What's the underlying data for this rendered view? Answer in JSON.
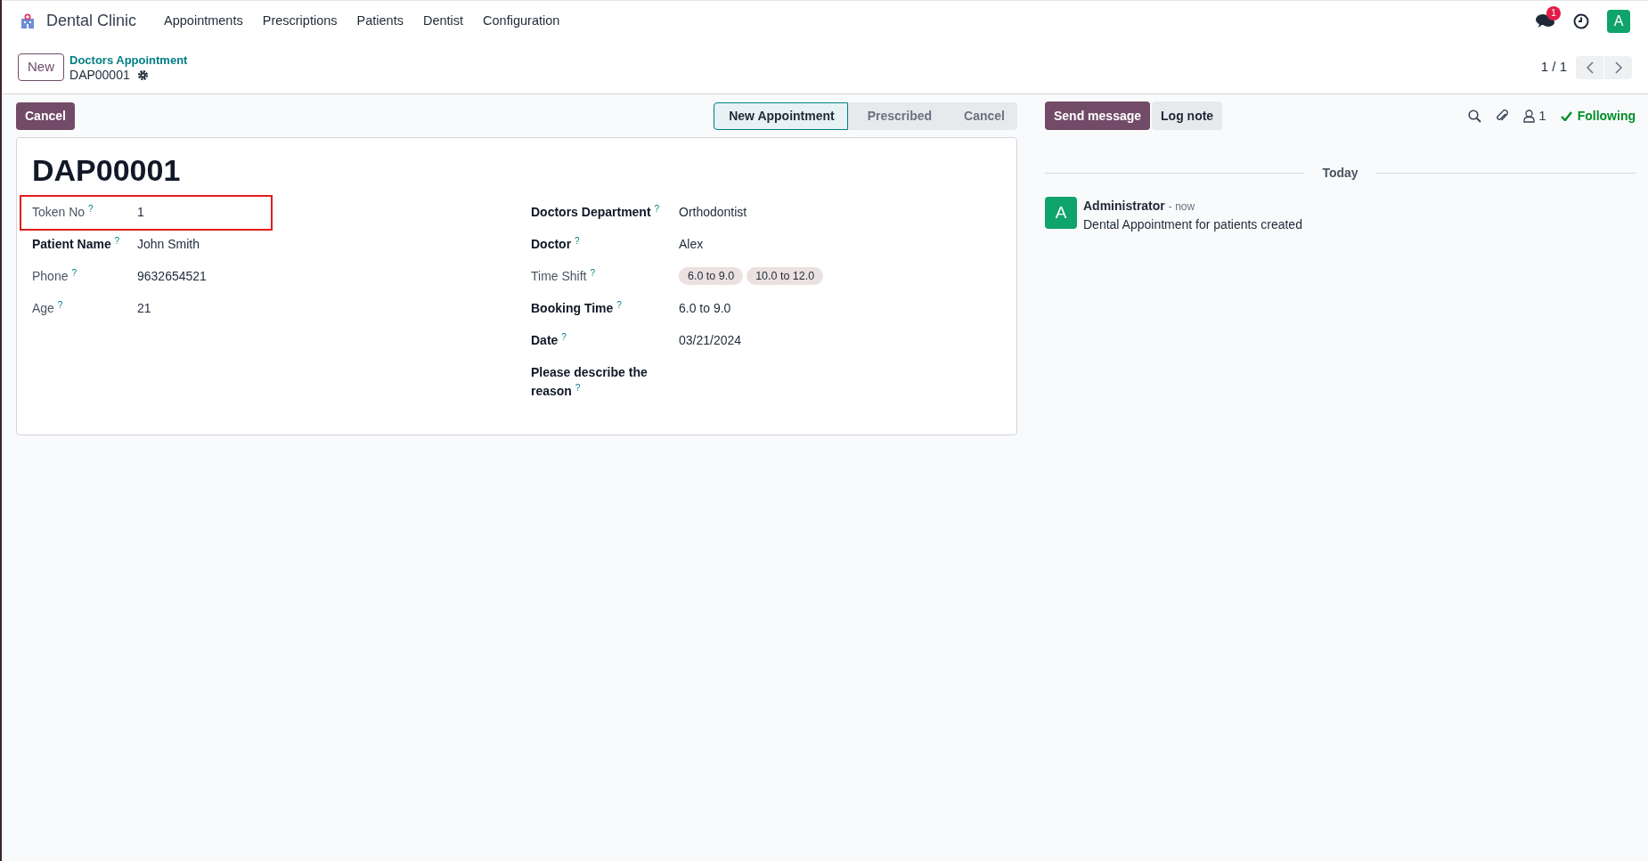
{
  "navbar": {
    "app_name": "Dental Clinic",
    "menu": [
      "Appointments",
      "Prescriptions",
      "Patients",
      "Dentist",
      "Configuration"
    ],
    "message_count": "1",
    "avatar": "A"
  },
  "control_panel": {
    "new_button": "New",
    "breadcrumb": "Doctors Appointment",
    "record_name": "DAP00001",
    "pager": "1 / 1"
  },
  "actions": {
    "cancel_button": "Cancel",
    "statusbar": [
      {
        "label": "New Appointment",
        "selected": true
      },
      {
        "label": "Prescribed",
        "selected": false
      },
      {
        "label": "Cancel",
        "selected": false
      }
    ]
  },
  "form": {
    "title": "DAP00001",
    "left_fields": [
      {
        "label": "Token No",
        "help": "?",
        "required": false,
        "highlighted": true,
        "kind": "text",
        "value": "1"
      },
      {
        "label": "Patient Name",
        "help": "?",
        "required": true,
        "highlighted": false,
        "kind": "text",
        "value": "John Smith"
      },
      {
        "label": "Phone",
        "help": "?",
        "required": false,
        "highlighted": false,
        "kind": "text",
        "value": "9632654521"
      },
      {
        "label": "Age",
        "help": "?",
        "required": false,
        "highlighted": false,
        "kind": "text",
        "value": "21"
      }
    ],
    "right_fields": [
      {
        "label": "Doctors Department",
        "help": "?",
        "required": true,
        "highlighted": false,
        "kind": "text",
        "value": "Orthodontist"
      },
      {
        "label": "Doctor",
        "help": "?",
        "required": true,
        "highlighted": false,
        "kind": "text",
        "value": "Alex"
      },
      {
        "label": "Time Shift",
        "help": "?",
        "required": false,
        "highlighted": false,
        "kind": "tags",
        "tags": [
          "6.0 to 9.0",
          "10.0 to 12.0"
        ]
      },
      {
        "label": "Booking Time",
        "help": "?",
        "required": true,
        "highlighted": false,
        "kind": "text",
        "value": "6.0 to 9.0"
      },
      {
        "label": "Date",
        "help": "?",
        "required": true,
        "highlighted": false,
        "kind": "text",
        "value": "03/21/2024"
      },
      {
        "label": "Please describe the reason",
        "help": "?",
        "required": true,
        "highlighted": false,
        "kind": "empty"
      }
    ]
  },
  "chatter": {
    "send_message_button": "Send message",
    "log_note_button": "Log note",
    "follower_count": "1",
    "following": "Following",
    "date_separator": "Today",
    "messages": [
      {
        "author": "Administrator",
        "time": "- now",
        "body": "Dental Appointment for patients created",
        "avatar": "A"
      }
    ]
  }
}
